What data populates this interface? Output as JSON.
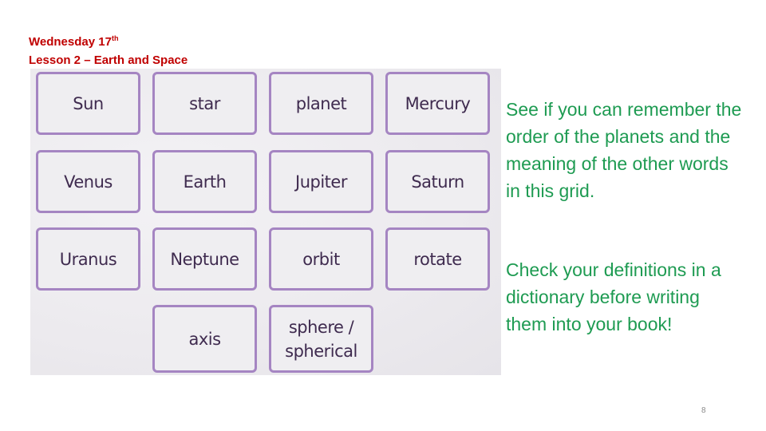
{
  "header": {
    "line1_prefix": "Wednesday 17",
    "line1_sup": "th",
    "line2": "Lesson 2 – Earth and Space"
  },
  "grid": {
    "rows": [
      [
        "Sun",
        "star",
        "planet",
        "Mercury"
      ],
      [
        "Venus",
        "Earth",
        "Jupiter",
        "Saturn"
      ],
      [
        "Uranus",
        "Neptune",
        "orbit",
        "rotate"
      ],
      [
        "",
        "axis",
        "sphere / spherical",
        ""
      ]
    ]
  },
  "instructions": {
    "paragraph1": "See if you can remember the order of the planets and the meaning of the other words in this grid.",
    "paragraph2": "Check your definitions in a dictionary before writing them into your book!"
  },
  "page_number": "8",
  "colors": {
    "title": "#c00000",
    "instructions": "#1e9b52",
    "card_border": "#a585c2",
    "card_text": "#3f2b4f"
  }
}
